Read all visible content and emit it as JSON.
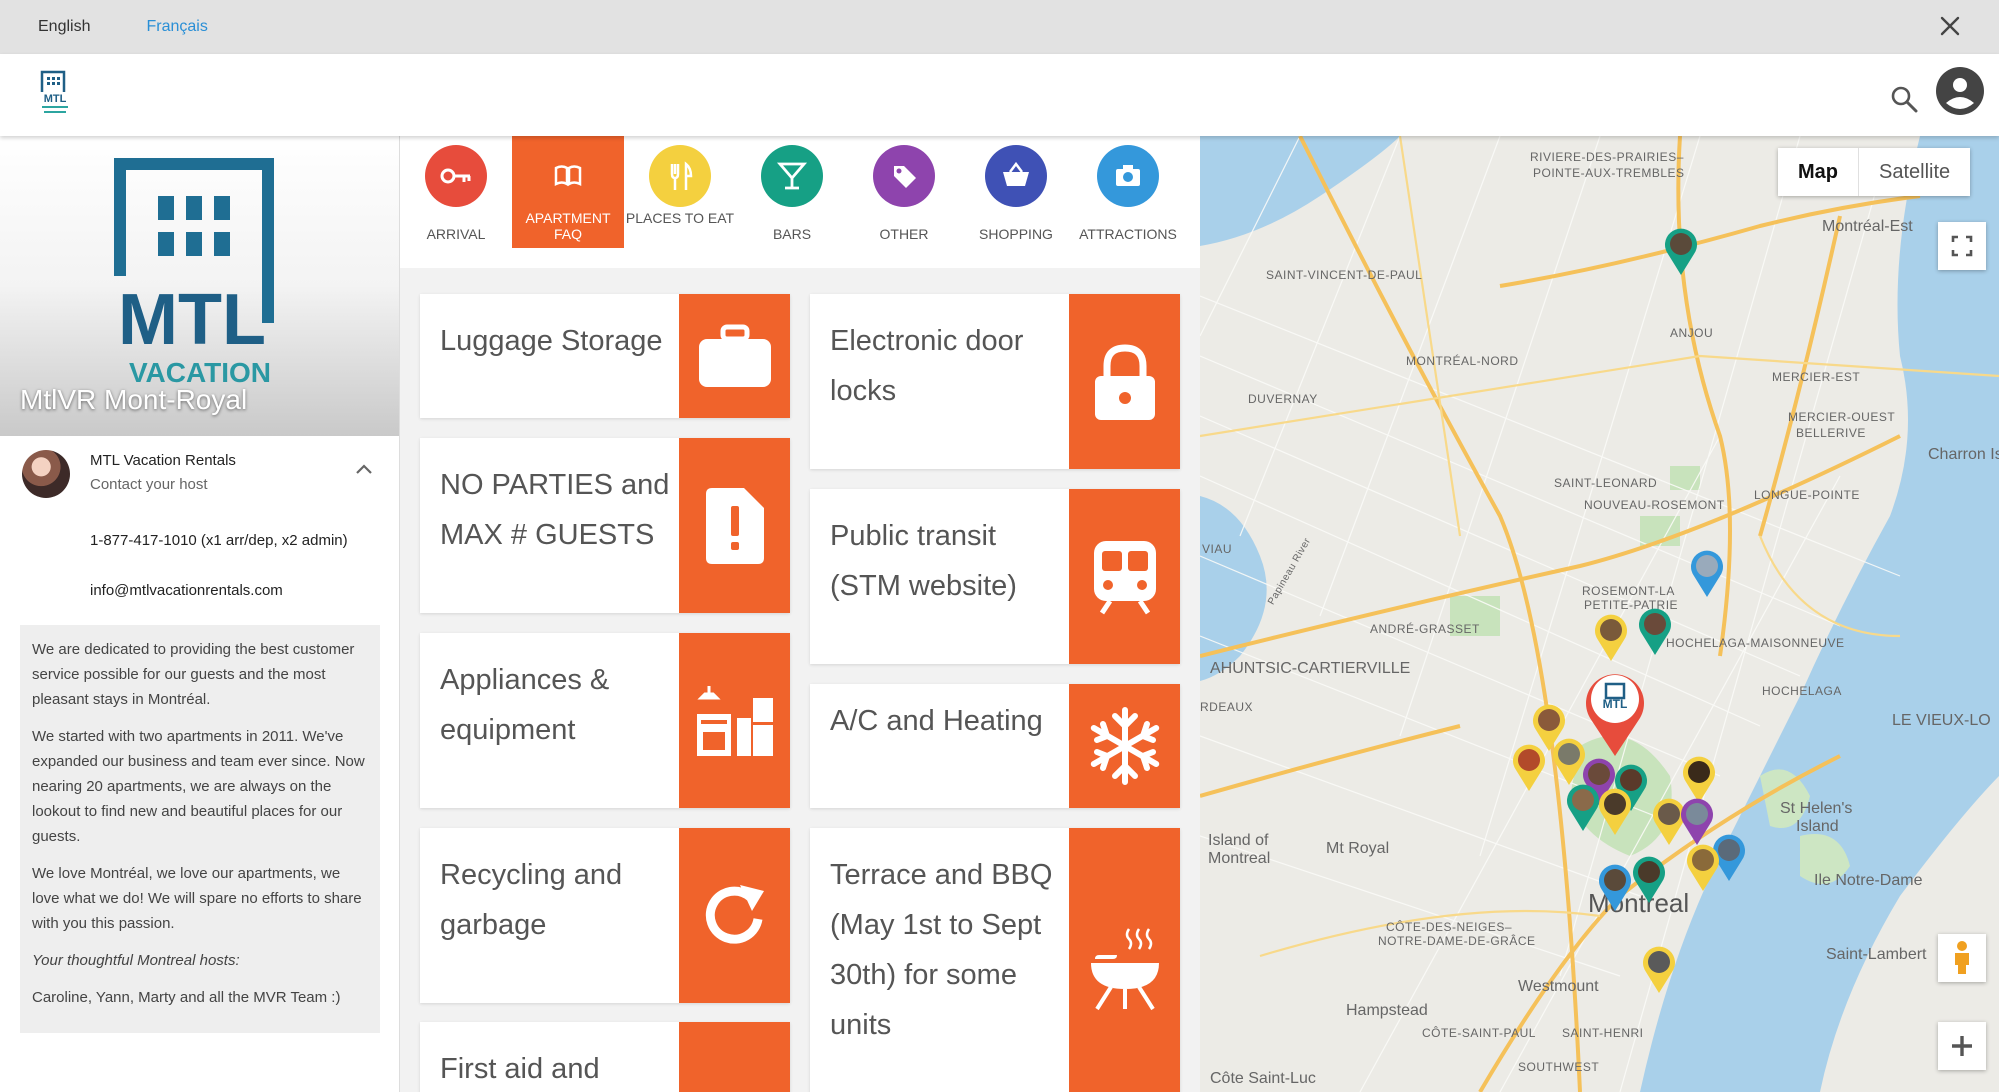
{
  "lang": {
    "en": "English",
    "fr": "Français"
  },
  "colors": {
    "accent": "#f0632b",
    "link": "#2a8fd6",
    "brand": "#1f5f86",
    "brandTeal": "#2ca5a0"
  },
  "property": {
    "title": "MtlVR Mont-Royal",
    "logo_text": "MTL",
    "logo_sub": "VACATION RENTALS"
  },
  "host": {
    "name": "MTL Vacation Rentals",
    "subtitle": "Contact your host",
    "phone": "1-877-417-1010 (x1 arr/dep, x2 admin)",
    "email": "info@mtlvacationrentals.com",
    "about": [
      "We are dedicated to providing the best customer service possible for our guests and the most pleasant stays in Montréal.",
      "We started with two apartments in 2011. We've expanded our business and team ever since. Now nearing 20 apartments, we are always on the lookout to find new and beautiful places for our guests.",
      "We love Montréal, we love our apartments, we love what we do! We will spare no efforts to share with you this passion.",
      "Your thoughtful Montreal hosts:",
      "Caroline, Yann, Marty and all the MVR Team :)"
    ]
  },
  "categories": [
    {
      "label": "ARRIVAL",
      "icon": "key-icon",
      "color": "#e74c3c"
    },
    {
      "label": "APARTMENT FAQ",
      "icon": "book-icon",
      "color": "#f0632b",
      "active": true
    },
    {
      "label": "PLACES TO EAT",
      "icon": "fork-knife-icon",
      "color": "#f4d03f"
    },
    {
      "label": "BARS",
      "icon": "cocktail-icon",
      "color": "#16a085"
    },
    {
      "label": "OTHER",
      "icon": "tag-icon",
      "color": "#8e44ad"
    },
    {
      "label": "SHOPPING",
      "icon": "basket-icon",
      "color": "#3f51b5"
    },
    {
      "label": "ATTRACTIONS",
      "icon": "camera-icon",
      "color": "#3498db"
    }
  ],
  "cards": [
    {
      "label": "Luggage Storage",
      "icon": "suitcase-icon"
    },
    {
      "label": "Electronic door locks",
      "icon": "padlock-icon"
    },
    {
      "label": "NO PARTIES and MAX # GUESTS",
      "icon": "alert-icon"
    },
    {
      "label": "Public transit (STM website)",
      "icon": "train-icon"
    },
    {
      "label": "Appliances & equipment",
      "icon": "kitchen-icon"
    },
    {
      "label": "A/C and Heating",
      "icon": "snowflake-icon"
    },
    {
      "label": "Recycling and garbage",
      "icon": "refresh-icon"
    },
    {
      "label": "Terrace and BBQ (May 1st to Sept 30th) for some units",
      "icon": "bbq-icon"
    },
    {
      "label": "First aid and",
      "icon": "first-aid-icon"
    }
  ],
  "map": {
    "toggle": {
      "map": "Map",
      "satellite": "Satellite"
    },
    "labels": [
      "RIVIERE-DES-PRAIRIES–",
      "POINTE-AUX-TREMBLES",
      "Montréal-Est",
      "SAINT-VINCENT-DE-PAUL",
      "ANJOU",
      "MONTRÉAL-NORD",
      "MERCIER-EST",
      "DUVERNAY",
      "MERCIER-OUEST",
      "BELLERIVE",
      "Charron Isl",
      "SAINT-LEONARD",
      "LONGUE-POINTE",
      "NOUVEAU-ROSEMONT",
      "VIAU",
      "ROSEMONT-LA",
      "PETITE-PATRIE",
      "ANDRÉ-GRASSET",
      "HOCHELAGA-MAISONNEUVE",
      "AHUNTSIC-CARTIERVILLE",
      "HOCHELAGA",
      "RDEAUX",
      "LE VIEUX-LO",
      "St Helen's",
      "Island",
      "Island of",
      "Montreal",
      "Mt Royal",
      "Ile Notre-Dame",
      "Montreal",
      "CÔTE-DES-NEIGES–",
      "NOTRE-DAME-DE-GRÂCE",
      "Saint-Lambert",
      "Westmount",
      "Hampstead",
      "CÔTE-SAINT-PAUL",
      "SAINT-HENRI",
      "SOUTHWEST",
      "Côte Saint-Luc",
      "Papineau River"
    ]
  }
}
